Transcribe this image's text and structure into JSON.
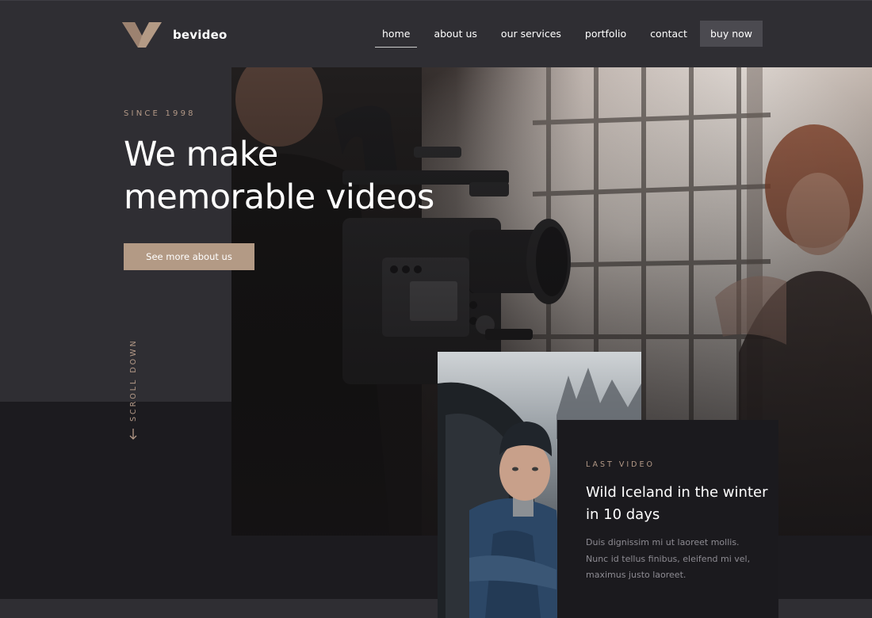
{
  "brand": {
    "name": "bevideo",
    "accent": "#b39a85"
  },
  "nav": {
    "items": [
      {
        "label": "home",
        "active": true
      },
      {
        "label": "about us",
        "active": false
      },
      {
        "label": "our services",
        "active": false
      },
      {
        "label": "portfolio",
        "active": false
      },
      {
        "label": "contact",
        "active": false
      }
    ],
    "buy_label": "buy now"
  },
  "hero": {
    "eyebrow": "SINCE 1998",
    "title_line1": "We make",
    "title_line2": "memorable videos",
    "cta_label": "See more about us",
    "scroll_label": "SCROLL DOWN",
    "photo_alt": "Camera operator filming a woman by a large window"
  },
  "last_video": {
    "eyebrow": "LAST VIDEO",
    "title": "Wild Iceland in the winter in 10 days",
    "description": "Duis dignissim mi ut laoreet mollis. Nunc id tellus finibus, eleifend mi vel, maximus justo laoreet.",
    "photo_alt": "Young man in beanie and denim jacket sitting in a car"
  },
  "icons": [
    "logo-v-icon",
    "arrow-down-icon"
  ]
}
